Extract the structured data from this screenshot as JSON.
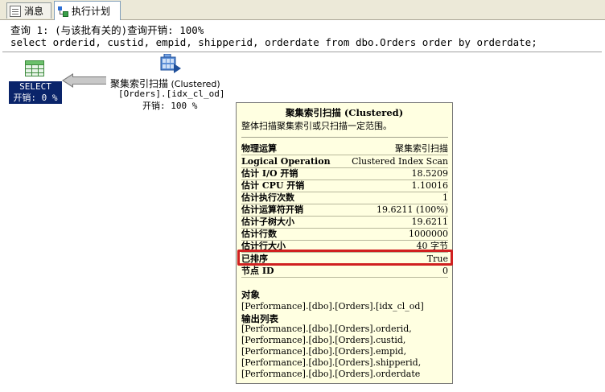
{
  "tabs": [
    {
      "label": "消息",
      "icon": "message-icon",
      "active": false
    },
    {
      "label": "执行计划",
      "icon": "execution-plan-icon",
      "active": true
    }
  ],
  "query": {
    "header": "查询 1: (与该批有关的)查询开销: 100%",
    "sql": "select orderid, custid, empid, shipperid, orderdate from dbo.Orders order by orderdate;"
  },
  "plan": {
    "select_node": {
      "label": "SELECT",
      "cost": "开销: 0 %"
    },
    "scan_node": {
      "name": "聚集索引扫描",
      "type": "(Clustered)",
      "object": "[Orders].[idx_cl_od]",
      "cost": "开销: 100 %"
    }
  },
  "tooltip": {
    "title": "聚集索引扫描 (Clustered)",
    "description": "整体扫描聚集索引或只扫描一定范围。",
    "properties": [
      {
        "key": "物理运算",
        "value": "聚集索引扫描"
      },
      {
        "key": "Logical Operation",
        "value": "Clustered Index Scan"
      },
      {
        "key": "估计 I/O 开销",
        "value": "18.5209"
      },
      {
        "key": "估计 CPU 开销",
        "value": "1.10016"
      },
      {
        "key": "估计执行次数",
        "value": "1"
      },
      {
        "key": "估计运算符开销",
        "value": "19.6211 (100%)"
      },
      {
        "key": "估计子树大小",
        "value": "19.6211"
      },
      {
        "key": "估计行数",
        "value": "1000000"
      },
      {
        "key": "估计行大小",
        "value": "40 字节"
      },
      {
        "key": "已排序",
        "value": "True"
      },
      {
        "key": "节点 ID",
        "value": "0"
      }
    ],
    "object_heading": "对象",
    "object_value": "[Performance].[dbo].[Orders].[idx_cl_od]",
    "output_heading": "输出列表",
    "output_list": [
      "[Performance].[dbo].[Orders].orderid,",
      "[Performance].[dbo].[Orders].custid,",
      "[Performance].[dbo].[Orders].empid,",
      "[Performance].[dbo].[Orders].shipperid,",
      "[Performance].[dbo].[Orders].orderdate"
    ]
  },
  "colors": {
    "highlight": "#d02020",
    "tooltip_bg": "#ffffe1",
    "selected": "#0a246a"
  }
}
